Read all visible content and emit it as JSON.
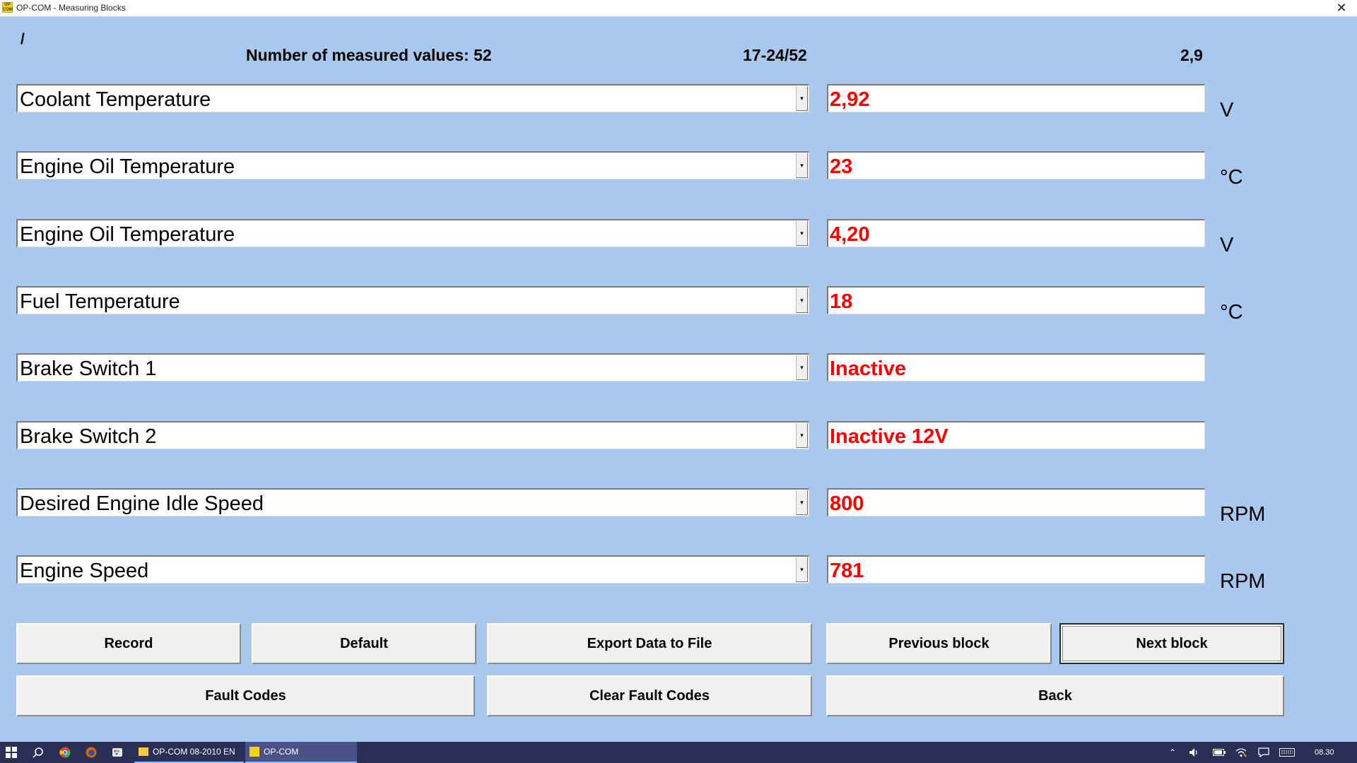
{
  "window": {
    "title": "OP-COM - Measuring Blocks",
    "icon_label": "OP COM",
    "close_glyph": "✕"
  },
  "header": {
    "slash": "/",
    "count_label": "Number of measured values: 52",
    "range_label": "17-24/52",
    "rate_label": "2,9"
  },
  "rows": [
    {
      "name": "Coolant Temperature",
      "value": "2,92",
      "unit": "V"
    },
    {
      "name": "Engine Oil Temperature",
      "value": "23",
      "unit": "°C"
    },
    {
      "name": "Engine Oil Temperature",
      "value": "4,20",
      "unit": "V"
    },
    {
      "name": "Fuel Temperature",
      "value": "18",
      "unit": "°C"
    },
    {
      "name": "Brake Switch 1",
      "value": "Inactive",
      "unit": ""
    },
    {
      "name": "Brake Switch 2",
      "value": "Inactive 12V",
      "unit": ""
    },
    {
      "name": "Desired Engine Idle Speed",
      "value": "800",
      "unit": "RPM"
    },
    {
      "name": "Engine Speed",
      "value": "781",
      "unit": "RPM"
    }
  ],
  "buttons": {
    "record": "Record",
    "default": "Default",
    "export": "Export Data to File",
    "previous_block": "Previous block",
    "next_block": "Next block",
    "fault_codes": "Fault Codes",
    "clear_fault_codes": "Clear Fault Codes",
    "back": "Back"
  },
  "taskbar": {
    "task1": "OP-COM 08-2010 EN",
    "task2": "OP-COM",
    "clock": "08.30"
  },
  "colors": {
    "window_bg": "#a8c8ee",
    "value_text": "#ff0000",
    "taskbar_bg": "#2a2f55"
  }
}
